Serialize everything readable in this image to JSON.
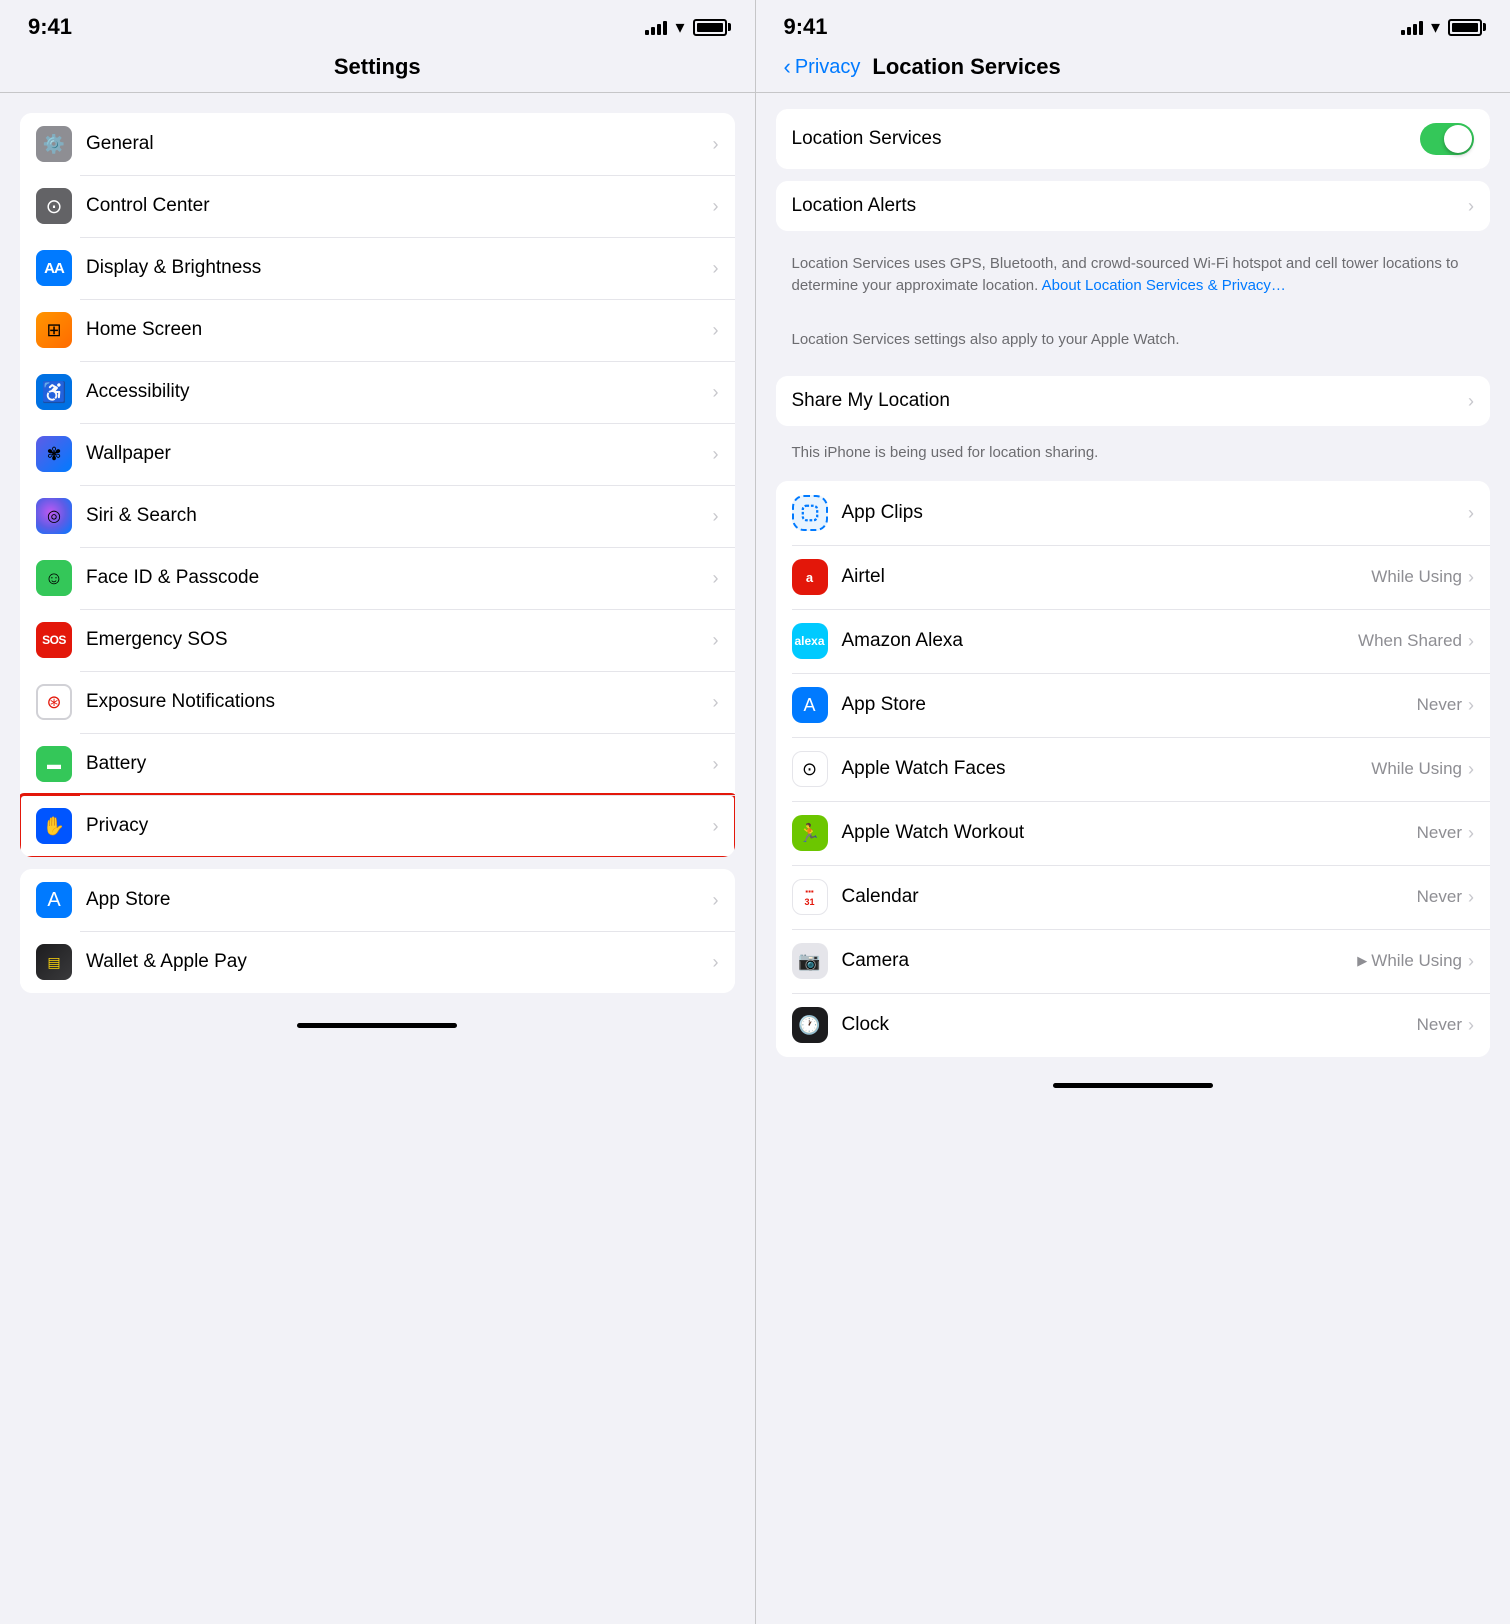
{
  "left": {
    "time": "9:41",
    "title": "Settings",
    "groups": [
      {
        "items": [
          {
            "id": "general",
            "label": "General",
            "icon": "⚙️",
            "iconClass": "ic-gray"
          },
          {
            "id": "control-center",
            "label": "Control Center",
            "icon": "◉",
            "iconClass": "ic-dark-gray"
          },
          {
            "id": "display-brightness",
            "label": "Display & Brightness",
            "icon": "AA",
            "iconClass": "ic-blue"
          },
          {
            "id": "home-screen",
            "label": "Home Screen",
            "icon": "⊞",
            "iconClass": "ic-orange"
          },
          {
            "id": "accessibility",
            "label": "Accessibility",
            "icon": "♿",
            "iconClass": "ic-blue-acc"
          },
          {
            "id": "wallpaper",
            "label": "Wallpaper",
            "icon": "✾",
            "iconClass": "ic-blue"
          },
          {
            "id": "siri-search",
            "label": "Siri & Search",
            "icon": "◎",
            "iconClass": "ic-siri"
          },
          {
            "id": "face-id",
            "label": "Face ID & Passcode",
            "icon": "☺",
            "iconClass": "ic-green"
          },
          {
            "id": "emergency-sos",
            "label": "Emergency SOS",
            "icon": "SOS",
            "iconClass": "ic-red"
          },
          {
            "id": "exposure",
            "label": "Exposure Notifications",
            "icon": "⊛",
            "iconClass": "ic-pink-dot"
          },
          {
            "id": "battery",
            "label": "Battery",
            "icon": "▬",
            "iconClass": "ic-green"
          },
          {
            "id": "privacy",
            "label": "Privacy",
            "icon": "✋",
            "iconClass": "ic-blue-priv",
            "highlighted": true
          }
        ]
      },
      {
        "items": [
          {
            "id": "app-store",
            "label": "App Store",
            "icon": "A",
            "iconClass": "ic-blue-appstore"
          },
          {
            "id": "wallet",
            "label": "Wallet & Apple Pay",
            "icon": "▤",
            "iconClass": "ic-wallet"
          }
        ]
      }
    ]
  },
  "right": {
    "time": "9:41",
    "back_label": "Privacy",
    "title": "Location Services",
    "toggle_label": "Location Services",
    "toggle_on": true,
    "description1": "Location Services uses GPS, Bluetooth, and crowd-sourced Wi-Fi hotspot and cell tower locations to determine your approximate location.",
    "description1_link": "About Location Services & Privacy…",
    "description2": "Location Services settings also apply to your Apple Watch.",
    "share_my_location": "Share My Location",
    "share_note": "This iPhone is being used for location sharing.",
    "apps": [
      {
        "id": "app-clips",
        "label": "App Clips",
        "value": "",
        "iconColor": "#007aff",
        "iconBg": "#e8f0fe",
        "iconBorder": true
      },
      {
        "id": "airtel",
        "label": "Airtel",
        "value": "While Using",
        "iconColor": "#e3170a",
        "iconBg": "#e3170a"
      },
      {
        "id": "amazon-alexa",
        "label": "Amazon Alexa",
        "value": "When Shared",
        "iconColor": "#00caff",
        "iconBg": "#00caff"
      },
      {
        "id": "app-store",
        "label": "App Store",
        "value": "Never",
        "iconColor": "#007aff",
        "iconBg": "#007aff"
      },
      {
        "id": "apple-watch-faces",
        "label": "Apple Watch Faces",
        "value": "While Using",
        "iconColor": "#000",
        "iconBg": "#fff"
      },
      {
        "id": "apple-watch-workout",
        "label": "Apple Watch Workout",
        "value": "Never",
        "iconColor": "#6cc600",
        "iconBg": "#6cc600"
      },
      {
        "id": "calendar",
        "label": "Calendar",
        "value": "Never",
        "iconColor": "#e3170a",
        "iconBg": "#fff"
      },
      {
        "id": "camera",
        "label": "Camera",
        "value": "While Using",
        "iconColor": "#555",
        "iconBg": "#e5e5ea",
        "hasArrow": true
      },
      {
        "id": "clock",
        "label": "Clock",
        "value": "Never",
        "iconColor": "#000",
        "iconBg": "#fff"
      }
    ]
  }
}
